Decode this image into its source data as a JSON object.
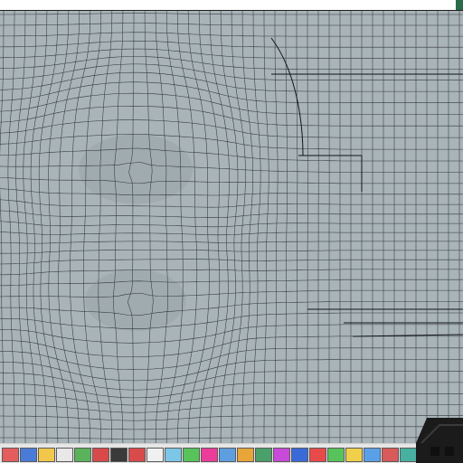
{
  "app": {
    "title": ""
  },
  "colors": {
    "background": "#a9b4b8",
    "mesh_line": "#1e2326",
    "taskbar": "#e6e6e6",
    "tray_device": "#1b1b1b",
    "accent": "#2b6b4a"
  },
  "viewport": {
    "content": "wireframe-mesh",
    "description_icon": "mesh-grid-icon"
  },
  "taskbar": {
    "tiles": [
      {
        "name": "task-tile-1",
        "color": "#e35d5d"
      },
      {
        "name": "task-tile-2",
        "color": "#4a7bd8"
      },
      {
        "name": "task-tile-3",
        "color": "#f1c84b"
      },
      {
        "name": "task-tile-4",
        "color": "#e8e8e8"
      },
      {
        "name": "task-tile-5",
        "color": "#5ab25a"
      },
      {
        "name": "task-tile-6",
        "color": "#d84a4a"
      },
      {
        "name": "task-tile-7",
        "color": "#3a3a3a"
      },
      {
        "name": "task-tile-8",
        "color": "#d94a4a"
      },
      {
        "name": "task-tile-9",
        "color": "#f0f0f0"
      },
      {
        "name": "task-tile-10",
        "color": "#7cc7e8"
      },
      {
        "name": "task-tile-11",
        "color": "#58c35a"
      },
      {
        "name": "task-tile-12",
        "color": "#ec3c9a"
      },
      {
        "name": "task-tile-13",
        "color": "#5d9fe0"
      },
      {
        "name": "task-tile-14",
        "color": "#e8a53a"
      },
      {
        "name": "task-tile-15",
        "color": "#4aa06a"
      },
      {
        "name": "task-tile-16",
        "color": "#c84ad8"
      },
      {
        "name": "task-tile-17",
        "color": "#3a6ad8"
      },
      {
        "name": "task-tile-18",
        "color": "#e84a4a"
      },
      {
        "name": "task-tile-19",
        "color": "#58c35a"
      },
      {
        "name": "task-tile-20",
        "color": "#f0d04a"
      },
      {
        "name": "task-tile-21",
        "color": "#5aa0e8"
      },
      {
        "name": "task-tile-22",
        "color": "#d85a5a"
      },
      {
        "name": "task-tile-23",
        "color": "#48b0a0"
      }
    ]
  }
}
